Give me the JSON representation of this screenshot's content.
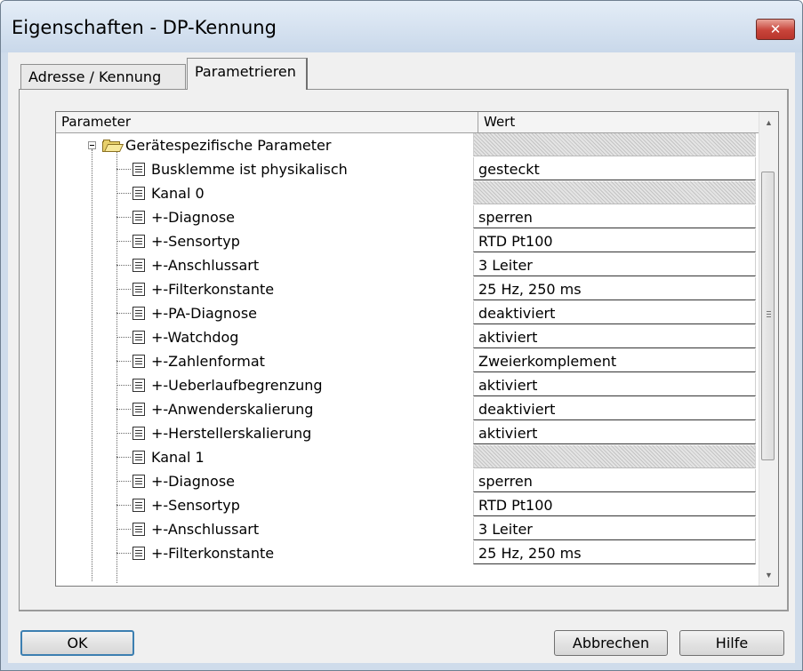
{
  "window": {
    "title": "Eigenschaften - DP-Kennung",
    "close_label": "✕"
  },
  "tabs": [
    {
      "label": "Adresse / Kennung"
    },
    {
      "label": "Parametrieren"
    }
  ],
  "grid": {
    "columns": [
      {
        "label": "Parameter"
      },
      {
        "label": "Wert"
      }
    ],
    "rows": [
      {
        "label": "Gerätespezifische Parameter",
        "value": "",
        "kind": "folder"
      },
      {
        "label": "Busklemme ist physikalisch",
        "value": "gesteckt",
        "kind": "param"
      },
      {
        "label": "Kanal 0",
        "value": "",
        "kind": "group"
      },
      {
        "label": "+-Diagnose",
        "value": "sperren",
        "kind": "param"
      },
      {
        "label": "+-Sensortyp",
        "value": "RTD Pt100",
        "kind": "param"
      },
      {
        "label": "+-Anschlussart",
        "value": "3 Leiter",
        "kind": "param"
      },
      {
        "label": "+-Filterkonstante",
        "value": "25 Hz, 250 ms",
        "kind": "param"
      },
      {
        "label": "+-PA-Diagnose",
        "value": "deaktiviert",
        "kind": "param"
      },
      {
        "label": "+-Watchdog",
        "value": "aktiviert",
        "kind": "param"
      },
      {
        "label": "+-Zahlenformat",
        "value": "Zweierkomplement",
        "kind": "param"
      },
      {
        "label": "+-Ueberlaufbegrenzung",
        "value": "aktiviert",
        "kind": "param"
      },
      {
        "label": "+-Anwenderskalierung",
        "value": "deaktiviert",
        "kind": "param"
      },
      {
        "label": "+-Herstellerskalierung",
        "value": "aktiviert",
        "kind": "param"
      },
      {
        "label": "Kanal 1",
        "value": "",
        "kind": "group"
      },
      {
        "label": "+-Diagnose",
        "value": "sperren",
        "kind": "param"
      },
      {
        "label": "+-Sensortyp",
        "value": "RTD Pt100",
        "kind": "param"
      },
      {
        "label": "+-Anschlussart",
        "value": "3 Leiter",
        "kind": "param"
      },
      {
        "label": "+-Filterkonstante",
        "value": "25 Hz, 250 ms",
        "kind": "param"
      }
    ]
  },
  "buttons": {
    "ok": "OK",
    "cancel": "Abbrechen",
    "help": "Hilfe"
  },
  "colors": {
    "title_bar": "#c9d8ea",
    "close_button": "#c8443a",
    "dialog_bg": "#f0f0f0",
    "ok_border": "#3c7fb1"
  }
}
